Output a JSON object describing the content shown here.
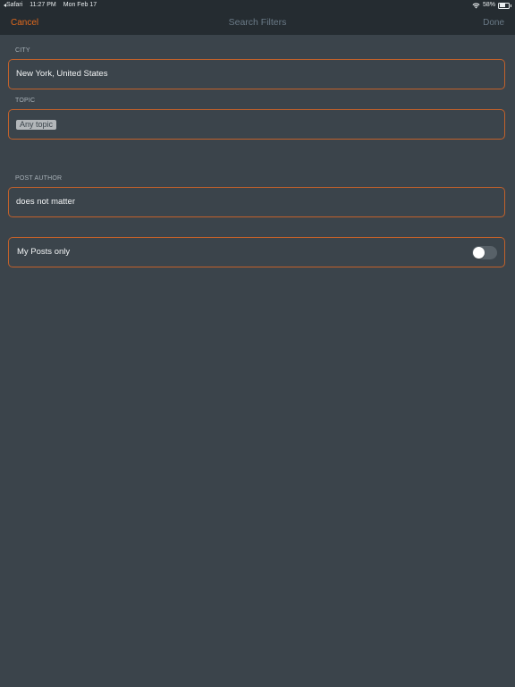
{
  "status_bar": {
    "back_app": "Safari",
    "time": "11:27 PM",
    "date": "Mon Feb 17",
    "battery_percent": "58%",
    "battery_level": 0.58
  },
  "nav": {
    "cancel_label": "Cancel",
    "title": "Search Filters",
    "done_label": "Done"
  },
  "form": {
    "city": {
      "label": "CITY",
      "value": "New York, United States"
    },
    "topic": {
      "label": "TOPIC",
      "chip": "Any topic"
    },
    "post_author": {
      "label": "POST AUTHOR",
      "value": "does not matter"
    },
    "my_posts": {
      "label": "My Posts only",
      "enabled": false
    }
  },
  "colors": {
    "accent": "#e0691d",
    "field_border": "#c2612a",
    "background": "#3b444b",
    "bar_background": "#252c31"
  }
}
